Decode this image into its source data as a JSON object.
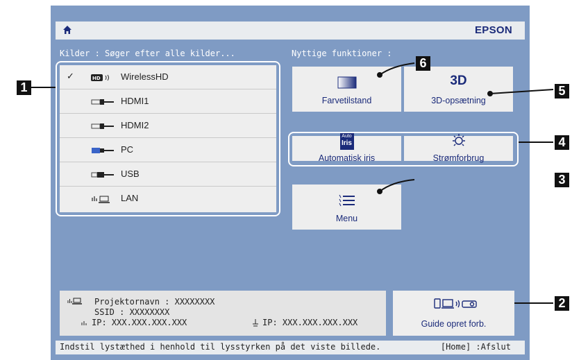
{
  "header": {
    "brand": "EPSON"
  },
  "sources": {
    "heading": "Kilder : Søger efter alle kilder...",
    "items": [
      {
        "label": "WirelessHD",
        "icon": "wirelesshd-icon",
        "checked": true
      },
      {
        "label": "HDMI1",
        "icon": "hdmi-icon",
        "checked": false
      },
      {
        "label": "HDMI2",
        "icon": "hdmi-icon",
        "checked": false
      },
      {
        "label": "PC",
        "icon": "vga-icon",
        "checked": false
      },
      {
        "label": "USB",
        "icon": "usb-icon",
        "checked": false
      },
      {
        "label": "LAN",
        "icon": "lan-icon",
        "checked": false
      }
    ],
    "check_mark": "✓"
  },
  "functions": {
    "heading": "Nyttige funktioner :",
    "color_mode": "Farvetilstand",
    "three_d": "3D-opsætning",
    "three_d_icon_text": "3D",
    "auto_iris": "Automatisk iris",
    "auto_iris_icon_top": "Auto",
    "auto_iris_icon_bottom": "Iris",
    "power": "Strømforbrug",
    "menu": "Menu"
  },
  "info": {
    "projector_name": "Projektornavn : XXXXXXXX",
    "ssid": "SSID : XXXXXXXX",
    "ip_wireless": "IP: XXX.XXX.XXX.XXX",
    "ip_wired": "IP: XXX.XXX.XXX.XXX"
  },
  "guide": {
    "label": "Guide opret forb."
  },
  "footer": {
    "hint": "Indstil lystæthed i henhold til lysstyrken på det viste billede.",
    "exit": "[Home] :Afslut"
  },
  "callouts": [
    "1",
    "2",
    "3",
    "4",
    "5",
    "6"
  ],
  "colors": {
    "screen_bg": "#7f9bc4",
    "tile_bg": "#eeeeee",
    "text_blue": "#1b2b7a"
  }
}
